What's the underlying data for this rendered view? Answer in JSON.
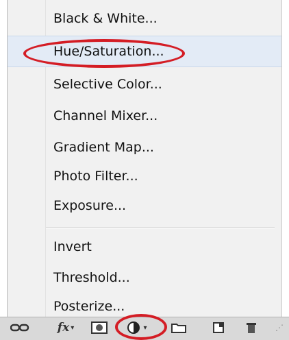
{
  "menu": {
    "items": [
      {
        "label": "Black & White..."
      },
      {
        "label": "Hue/Saturation..."
      },
      {
        "label": "Selective Color..."
      },
      {
        "label": "Channel Mixer..."
      },
      {
        "label": "Gradient Map..."
      },
      {
        "label": "Photo Filter..."
      },
      {
        "label": "Exposure..."
      },
      {
        "label": "Invert"
      },
      {
        "label": "Threshold..."
      },
      {
        "label": "Posterize..."
      }
    ],
    "highlighted_item": "Hue/Saturation..."
  },
  "toolbar": {
    "icons": [
      "link-icon",
      "fx-icon",
      "mask-icon",
      "adjustment-layer-icon",
      "group-folder-icon",
      "new-layer-icon",
      "trash-icon",
      "resize-grip-icon"
    ],
    "fx_label": "fx"
  },
  "colors": {
    "highlight": "#e3ebf6",
    "annotation": "#d41d25"
  }
}
